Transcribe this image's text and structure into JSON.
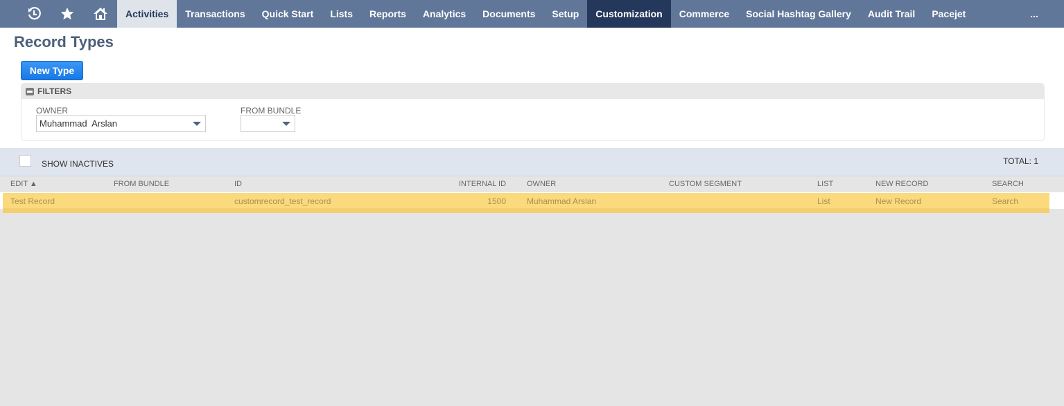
{
  "nav": {
    "icons": [
      "recent-records-icon",
      "favorites-star-icon",
      "home-icon"
    ],
    "items": [
      {
        "label": "Activities",
        "state": "hover"
      },
      {
        "label": "Transactions"
      },
      {
        "label": "Quick Start"
      },
      {
        "label": "Lists"
      },
      {
        "label": "Reports"
      },
      {
        "label": "Analytics"
      },
      {
        "label": "Documents"
      },
      {
        "label": "Setup"
      },
      {
        "label": "Customization",
        "state": "active"
      },
      {
        "label": "Commerce"
      },
      {
        "label": "Social Hashtag Gallery"
      },
      {
        "label": "Audit Trail"
      },
      {
        "label": "Pacejet"
      }
    ],
    "more_label": "..."
  },
  "page": {
    "title": "Record Types",
    "new_button": "New Type"
  },
  "filters": {
    "title": "FILTERS",
    "owner_label": "OWNER",
    "owner_value": "Muhammad  Arslan",
    "bundle_label": "FROM BUNDLE",
    "bundle_value": ""
  },
  "list": {
    "show_inactives_label": "SHOW INACTIVES",
    "show_inactives_checked": false,
    "total_label": "TOTAL: 1",
    "columns": [
      "EDIT ▲",
      "FROM BUNDLE",
      "ID",
      "INTERNAL ID",
      "OWNER",
      "CUSTOM SEGMENT",
      "LIST",
      "NEW RECORD",
      "SEARCH"
    ],
    "rows": [
      {
        "edit": "Test Record",
        "from_bundle": "",
        "id": "customrecord_test_record",
        "internal_id": "1500",
        "owner": "Muhammad Arslan",
        "custom_segment": "",
        "list": "List",
        "new_record": "New Record",
        "search": "Search"
      }
    ]
  },
  "colors": {
    "nav_bg": "#607799",
    "nav_active": "#24385b",
    "button_blue": "#1f86f0",
    "row_highlight": "#fbd97d"
  }
}
